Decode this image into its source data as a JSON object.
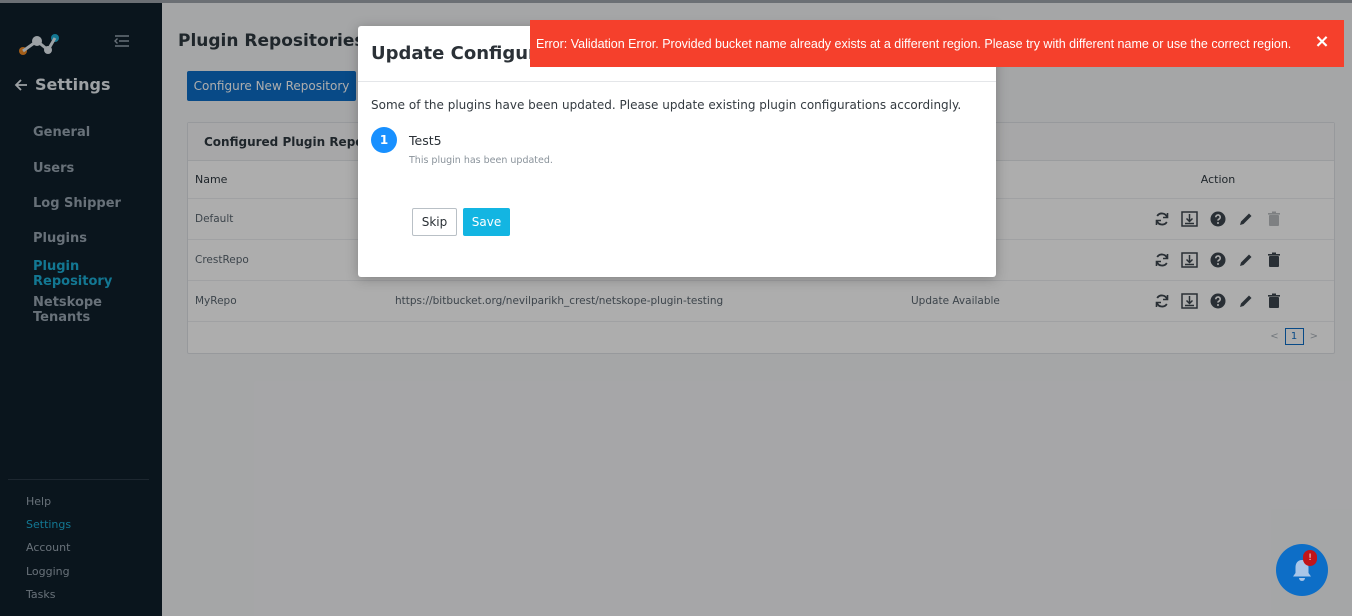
{
  "sidebar": {
    "back_label": "Settings",
    "nav": [
      {
        "label": "General",
        "name": "sidebar-item-general",
        "active": false
      },
      {
        "label": "Users",
        "name": "sidebar-item-users",
        "active": false
      },
      {
        "label": "Log Shipper",
        "name": "sidebar-item-log-shipper",
        "active": false
      },
      {
        "label": "Plugins",
        "name": "sidebar-item-plugins",
        "active": false
      },
      {
        "label": "Plugin Repository",
        "name": "sidebar-item-plugin-repository",
        "active": true
      },
      {
        "label": "Netskope Tenants",
        "name": "sidebar-item-netskope-tenants",
        "active": false
      }
    ],
    "bottom": [
      {
        "label": "Help",
        "name": "bottom-item-help",
        "active": false
      },
      {
        "label": "Settings",
        "name": "bottom-item-settings",
        "active": true
      },
      {
        "label": "Account",
        "name": "bottom-item-account",
        "active": false
      },
      {
        "label": "Logging",
        "name": "bottom-item-logging",
        "active": false
      },
      {
        "label": "Tasks",
        "name": "bottom-item-tasks",
        "active": false
      }
    ]
  },
  "main": {
    "title": "Plugin Repositories",
    "configure_button": "Configure New Repository",
    "panel_title": "Configured Plugin Repositories",
    "columns": {
      "name": "Name",
      "action": "Action"
    },
    "rows": [
      {
        "name": "Default",
        "url": "",
        "status": "",
        "delete_disabled": true
      },
      {
        "name": "CrestRepo",
        "url": "",
        "status": "",
        "delete_disabled": false
      },
      {
        "name": "MyRepo",
        "url": "https://bitbucket.org/nevilparikh_crest/netskope-plugin-testing",
        "status": "Update Available",
        "delete_disabled": false
      }
    ],
    "pagination": {
      "prev": "<",
      "current": "1",
      "next": ">"
    }
  },
  "modal": {
    "title": "Update Configurations",
    "message": "Some of the plugins have been updated. Please update existing plugin configurations accordingly.",
    "step_number": "1",
    "plugin_name": "Test5",
    "plugin_note": "This plugin has been updated.",
    "skip_label": "Skip",
    "save_label": "Save"
  },
  "toast": {
    "message": "Error: Validation Error. Provided bucket name already exists at a different region. Please try with different name or use the correct region.",
    "close": "×",
    "color": "#f5402c"
  },
  "notifications": {
    "badge": "!"
  },
  "colors": {
    "accent": "#1cb0d8",
    "primary": "#0d6ec7",
    "sidebar": "#0f1f2b"
  }
}
